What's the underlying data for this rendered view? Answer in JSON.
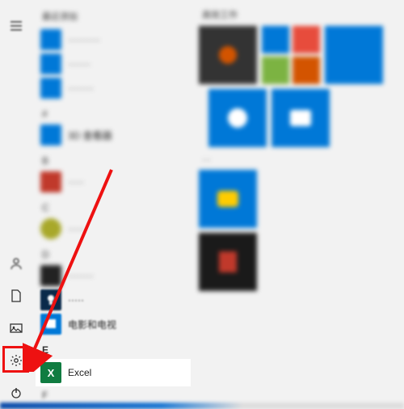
{
  "rail": {
    "menu": "menu",
    "user": "user",
    "documents": "documents",
    "pictures": "pictures",
    "settings": "settings",
    "power": "power"
  },
  "apps": {
    "header_recent": "最近添加",
    "recent": [
      {
        "label": "··········",
        "color": "#0078d7"
      },
      {
        "label": "·······",
        "color": "#0078d7"
      },
      {
        "label": "········",
        "color": "#0078d7"
      }
    ],
    "letter_hash": "#",
    "hash_items": [
      {
        "label": "3D 查看器",
        "color": "#0078d7"
      }
    ],
    "letter_b": "B",
    "b_items": [
      {
        "label": "·····",
        "color": "#c0392b"
      }
    ],
    "letter_c": "C",
    "c_items": [
      {
        "label": "·····",
        "color": "#8a8a23"
      }
    ],
    "letter_d": "D",
    "d_items": [
      {
        "label": "········",
        "color": "#222"
      },
      {
        "label": "·····",
        "color": "#0a2a4a"
      },
      {
        "label": "电影和电视",
        "color": "#0078d7"
      }
    ],
    "letter_e": "E",
    "e_items": [
      {
        "label": "Excel",
        "color": "#107c41"
      }
    ],
    "letter_f": "F"
  },
  "tiles": {
    "group1": "高效工作",
    "group2": "···"
  }
}
